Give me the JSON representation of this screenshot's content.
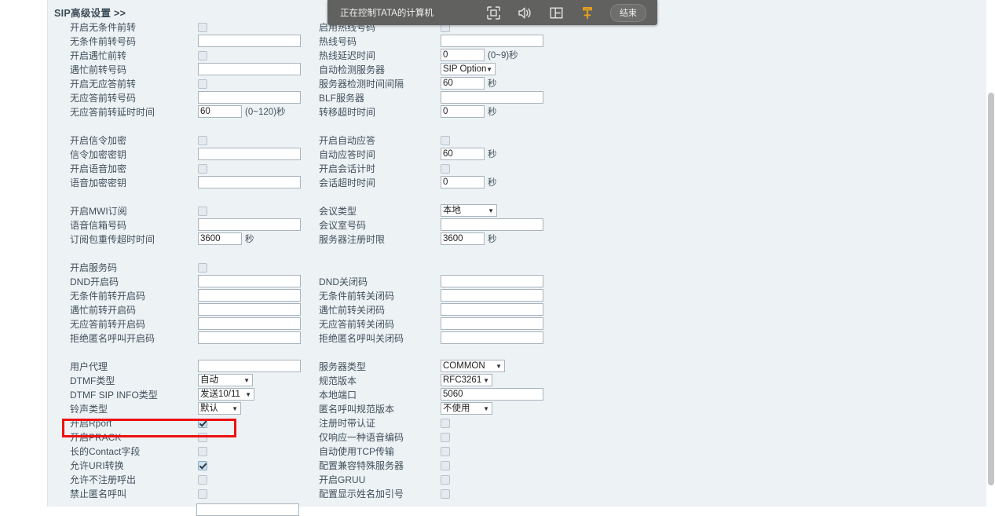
{
  "page": {
    "section_title": "SIP高级设置 >>"
  },
  "remote_toolbar": {
    "title": "正在控制TATA的计算机",
    "end_label": "结束",
    "icons": [
      {
        "name": "fullscreen-icon",
        "label": "全屏"
      },
      {
        "name": "speaker-icon",
        "label": "声音"
      },
      {
        "name": "split-screen-icon",
        "label": "分屏"
      },
      {
        "name": "pin-icon",
        "label": "固定",
        "color": "#e8a219"
      }
    ]
  },
  "groups": [
    {
      "id": "forward",
      "rows": [
        {
          "left": {
            "label": "开启无条件前转",
            "type": "checkbox",
            "checked": false
          },
          "right": {
            "label": "启用热线号码",
            "type": "checkbox",
            "checked": false
          }
        },
        {
          "left": {
            "label": "无条件前转号码",
            "type": "text",
            "value": "",
            "width": "long"
          },
          "right": {
            "label": "热线号码",
            "type": "text",
            "value": "",
            "width": "long"
          }
        },
        {
          "left": {
            "label": "开启遇忙前转",
            "type": "checkbox",
            "checked": false
          },
          "right": {
            "label": "热线延迟时间",
            "type": "text",
            "value": "0",
            "width": "short",
            "suffix": "(0~9)秒"
          }
        },
        {
          "left": {
            "label": "遇忙前转号码",
            "type": "text",
            "value": "",
            "width": "long"
          },
          "right": {
            "label": "自动检测服务器",
            "type": "select",
            "value": "SIP Option",
            "width": "w-70"
          }
        },
        {
          "left": {
            "label": "开启无应答前转",
            "type": "checkbox",
            "checked": false
          },
          "right": {
            "label": "服务器检测时间间隔",
            "type": "text",
            "value": "60",
            "width": "short",
            "suffix": "秒"
          }
        },
        {
          "left": {
            "label": "无应答前转号码",
            "type": "text",
            "value": "",
            "width": "long"
          },
          "right": {
            "label": "BLF服务器",
            "type": "text",
            "value": "",
            "width": "long"
          }
        },
        {
          "left": {
            "label": "无应答前转延时时间",
            "type": "text",
            "value": "60",
            "width": "short",
            "suffix": "(0~120)秒"
          },
          "right": {
            "label": "转移超时时间",
            "type": "text",
            "value": "0",
            "width": "short",
            "suffix": "秒"
          }
        }
      ]
    },
    {
      "id": "encryption",
      "rows": [
        {
          "left": {
            "label": "开启信令加密",
            "type": "checkbox",
            "checked": false
          },
          "right": {
            "label": "开启自动应答",
            "type": "checkbox",
            "checked": false
          }
        },
        {
          "left": {
            "label": "信令加密密钥",
            "type": "text",
            "value": "",
            "width": "long"
          },
          "right": {
            "label": "自动应答时间",
            "type": "text",
            "value": "60",
            "width": "short",
            "suffix": "秒"
          }
        },
        {
          "left": {
            "label": "开启语音加密",
            "type": "checkbox",
            "checked": false
          },
          "right": {
            "label": "开启会话计时",
            "type": "checkbox",
            "checked": false
          }
        },
        {
          "left": {
            "label": "语音加密密钥",
            "type": "text",
            "value": "",
            "width": "long"
          },
          "right": {
            "label": "会话超时时间",
            "type": "text",
            "value": "0",
            "width": "short",
            "suffix": "秒"
          }
        }
      ]
    },
    {
      "id": "mwi",
      "rows": [
        {
          "left": {
            "label": "开启MWI订阅",
            "type": "checkbox",
            "checked": false
          },
          "right": {
            "label": "会议类型",
            "type": "select",
            "value": "本地",
            "width": "w-72"
          }
        },
        {
          "left": {
            "label": "语音信箱号码",
            "type": "text",
            "value": "",
            "width": "long"
          },
          "right": {
            "label": "会议室号码",
            "type": "text",
            "value": "",
            "width": "long"
          }
        },
        {
          "left": {
            "label": "订阅包重传超时时间",
            "type": "text",
            "value": "3600",
            "width": "short",
            "suffix": "秒"
          },
          "right": {
            "label": "服务器注册时限",
            "type": "text",
            "value": "3600",
            "width": "short",
            "suffix": "秒"
          }
        }
      ]
    },
    {
      "id": "service-codes",
      "rows": [
        {
          "left": {
            "label": "开启服务码",
            "type": "checkbox",
            "checked": false
          },
          "right": {
            "label": "",
            "type": "none"
          }
        },
        {
          "left": {
            "label": "DND开启码",
            "type": "text",
            "value": "",
            "width": "long"
          },
          "right": {
            "label": "DND关闭码",
            "type": "text",
            "value": "",
            "width": "long"
          }
        },
        {
          "left": {
            "label": "无条件前转开启码",
            "type": "text",
            "value": "",
            "width": "long"
          },
          "right": {
            "label": "无条件前转关闭码",
            "type": "text",
            "value": "",
            "width": "long"
          }
        },
        {
          "left": {
            "label": "遇忙前转开启码",
            "type": "text",
            "value": "",
            "width": "long"
          },
          "right": {
            "label": "遇忙前转关闭码",
            "type": "text",
            "value": "",
            "width": "long"
          }
        },
        {
          "left": {
            "label": "无应答前转开启码",
            "type": "text",
            "value": "",
            "width": "long"
          },
          "right": {
            "label": "无应答前转关闭码",
            "type": "text",
            "value": "",
            "width": "long"
          }
        },
        {
          "left": {
            "label": "拒绝匿名呼叫开启码",
            "type": "text",
            "value": "",
            "width": "long"
          },
          "right": {
            "label": "拒绝匿名呼叫关闭码",
            "type": "text",
            "value": "",
            "width": "long"
          }
        }
      ]
    },
    {
      "id": "advanced",
      "rows": [
        {
          "left": {
            "label": "用户代理",
            "type": "text",
            "value": "",
            "width": "long"
          },
          "right": {
            "label": "服务器类型",
            "type": "select",
            "value": "COMMON",
            "width": "w-82"
          }
        },
        {
          "left": {
            "label": "DTMF类型",
            "type": "select",
            "value": "自动",
            "width": "w-70"
          },
          "right": {
            "label": "规范版本",
            "type": "select",
            "value": "RFC3261",
            "width": "w-66"
          }
        },
        {
          "left": {
            "label": "DTMF SIP INFO类型",
            "type": "select",
            "value": "发送10/11",
            "width": "w-72"
          },
          "right": {
            "label": "本地端口",
            "type": "text",
            "value": "5060",
            "width": "long"
          }
        },
        {
          "left": {
            "label": "铃声类型",
            "type": "select",
            "value": "默认",
            "width": "w-55"
          },
          "right": {
            "label": "匿名呼叫规范版本",
            "type": "select",
            "value": "不使用",
            "width": "w-66"
          }
        },
        {
          "left": {
            "label": "开启Rport",
            "type": "checkbox",
            "checked": true,
            "highlighted": true
          },
          "right": {
            "label": "注册时带认证",
            "type": "checkbox",
            "checked": false
          }
        },
        {
          "left": {
            "label": "开启PRACK",
            "type": "checkbox",
            "checked": false
          },
          "right": {
            "label": "仅响应一种语音编码",
            "type": "checkbox",
            "checked": false
          }
        },
        {
          "left": {
            "label": "长的Contact字段",
            "type": "checkbox",
            "checked": false
          },
          "right": {
            "label": "自动使用TCP传输",
            "type": "checkbox",
            "checked": false
          }
        },
        {
          "left": {
            "label": "允许URI转换",
            "type": "checkbox",
            "checked": true
          },
          "right": {
            "label": "配置兼容特殊服务器",
            "type": "checkbox",
            "checked": false
          }
        },
        {
          "left": {
            "label": "允许不注册呼出",
            "type": "checkbox",
            "checked": false
          },
          "right": {
            "label": "开启GRUU",
            "type": "checkbox",
            "checked": false
          }
        },
        {
          "left": {
            "label": "禁止匿名呼叫",
            "type": "checkbox",
            "checked": false
          },
          "right": {
            "label": "配置显示姓名加引号",
            "type": "checkbox",
            "checked": false
          }
        }
      ]
    }
  ],
  "colors": {
    "panel_bg": "#edf2f5",
    "highlight": "#ee1111",
    "toolbar_bg": "#61625f",
    "pin_accent": "#e8a219"
  }
}
